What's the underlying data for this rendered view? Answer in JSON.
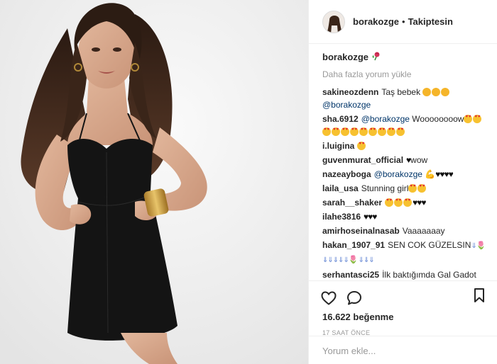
{
  "header": {
    "username": "borakozge",
    "separator": "•",
    "follow_status": "Takiptesin"
  },
  "caption": {
    "username": "borakozge",
    "badge_icon": "rose-emoji"
  },
  "load_more": "Daha fazla yorum yükle",
  "comments": [
    {
      "user": "sakineozdenn",
      "text": "Taş bebek",
      "tail": "@borakozge"
    },
    {
      "user": "sha.6912",
      "mention": "@borakozge",
      "text": "Woooooooow"
    },
    {
      "user": "i.luigina",
      "text": ""
    },
    {
      "user": "guvenmurat_official",
      "text": "wow"
    },
    {
      "user": "nazeayboga",
      "mention": "@borakozge",
      "text": ""
    },
    {
      "user": "laila_usa",
      "text": "Stunning girl"
    },
    {
      "user": "sarah__shaker",
      "text": ""
    },
    {
      "user": "ilahe3816",
      "text": ""
    },
    {
      "user": "amirhoseinalnasab",
      "text": "Vaaaaaaay"
    },
    {
      "user": "hakan_1907_91",
      "text": "SEN COK GÜZELSIN"
    },
    {
      "user": "serhantasci25",
      "text": "İlk baktığımda Gal Gadot"
    }
  ],
  "likes": "16.622 beğenme",
  "timestamp": "17 SAAT ÖNCE",
  "comment_input": {
    "placeholder": "Yorum ekle..."
  },
  "colors": {
    "text": "#262626",
    "muted": "#999999",
    "border": "#efefef",
    "mention": "#003569"
  }
}
